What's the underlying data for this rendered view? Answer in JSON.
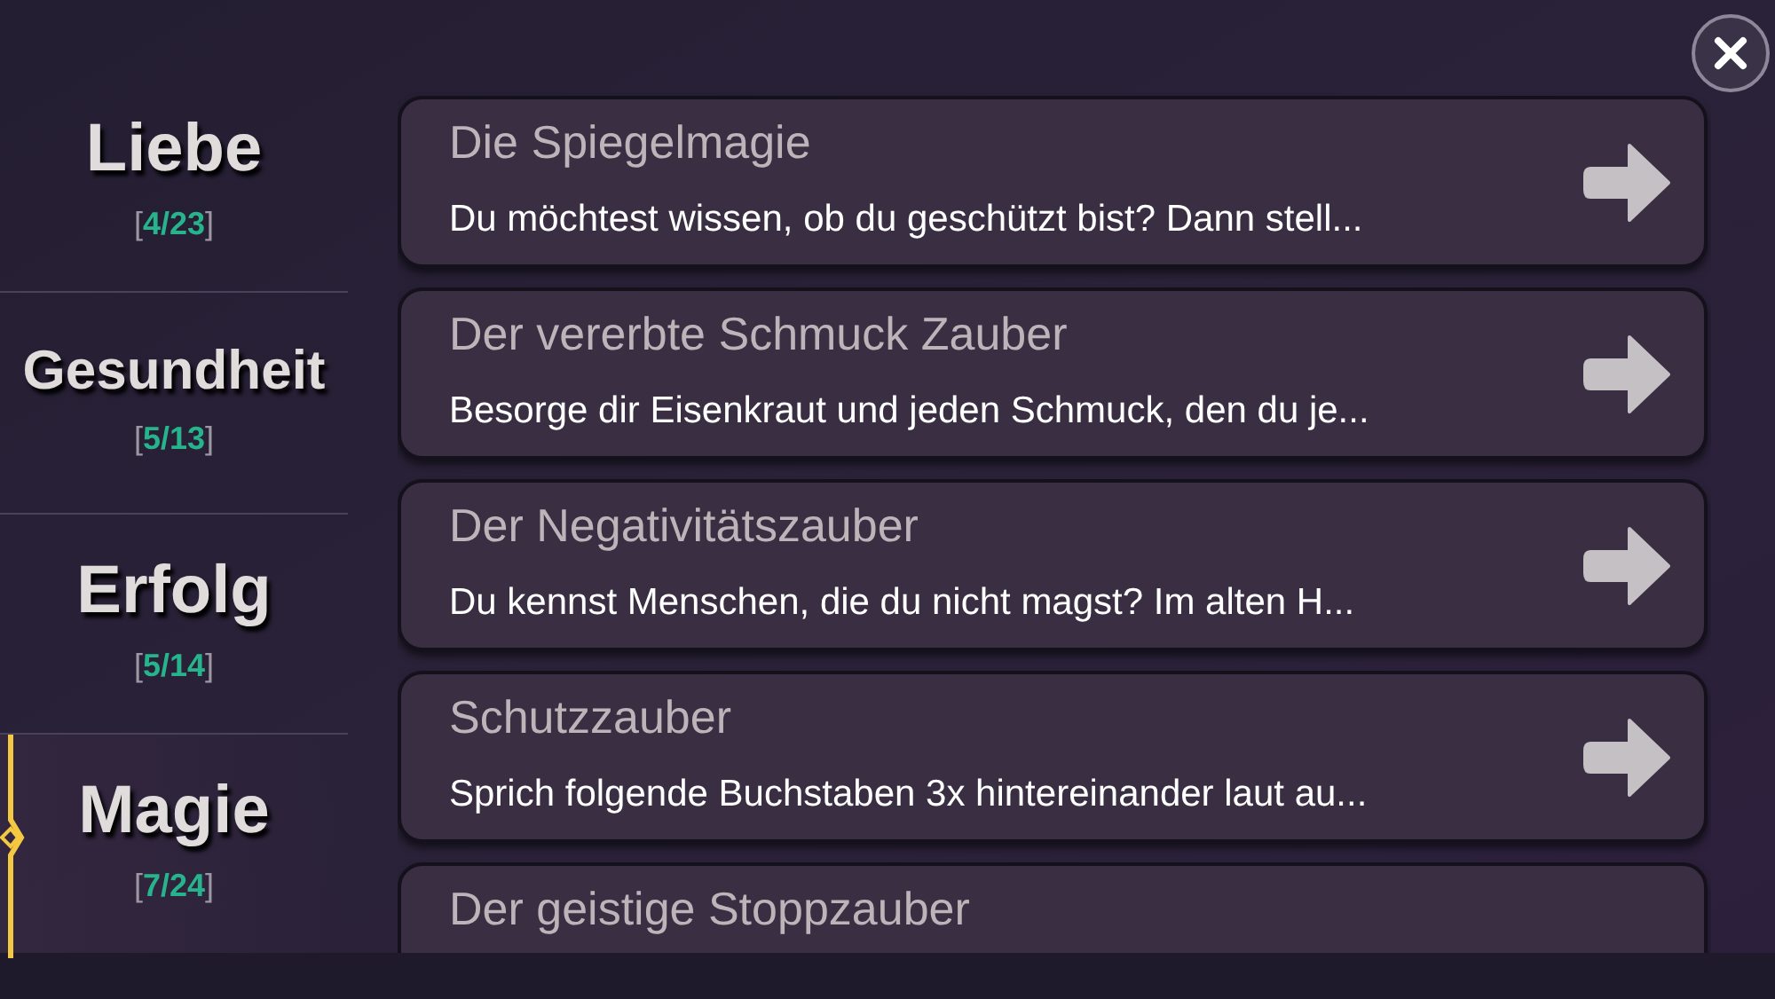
{
  "categories": [
    {
      "name": "Liebe",
      "count": "[4/23]",
      "selected": false
    },
    {
      "name": "Gesundheit",
      "count": "[5/13]",
      "selected": false
    },
    {
      "name": "Erfolg",
      "count": "[5/14]",
      "selected": false
    },
    {
      "name": "Magie",
      "count": "[7/24]",
      "selected": true
    }
  ],
  "spells": [
    {
      "title": "Die Spiegelmagie",
      "preview": "Du möchtest wissen, ob du geschützt bist? Dann stell..."
    },
    {
      "title": "Der vererbte Schmuck Zauber",
      "preview": "Besorge dir Eisenkraut und jeden Schmuck, den du je..."
    },
    {
      "title": "Der Negativitätszauber",
      "preview": "Du kennst Menschen, die du nicht magst? Im alten H..."
    },
    {
      "title": "Schutzzauber",
      "preview": "Sprich folgende Buchstaben 3x hintereinander laut au..."
    },
    {
      "title": "Der geistige Stoppzauber"
    }
  ]
}
